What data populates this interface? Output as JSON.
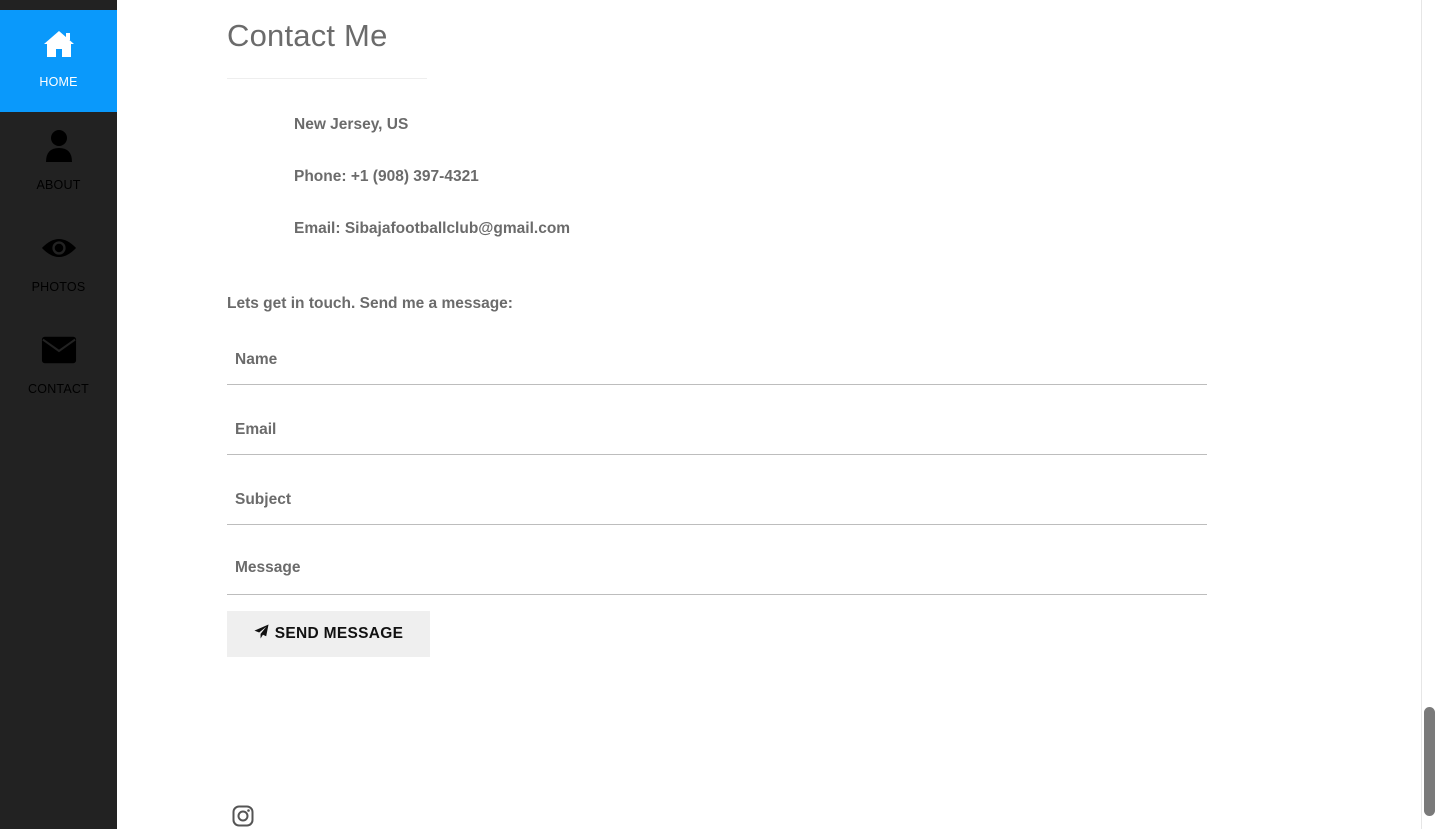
{
  "sidebar": {
    "items": [
      {
        "label": "HOME",
        "icon": "home-icon",
        "active": true
      },
      {
        "label": "ABOUT",
        "icon": "user-icon",
        "active": false
      },
      {
        "label": "PHOTOS",
        "icon": "eye-icon",
        "active": false
      },
      {
        "label": "CONTACT",
        "icon": "envelope-icon",
        "active": false
      }
    ],
    "accent_color": "#0a99fb",
    "background_color": "#222222"
  },
  "contact": {
    "title": "Contact Me",
    "address": "New Jersey, US",
    "phone": "Phone: +1 (908) 397-4321",
    "email": "Email: Sibajafootballclub@gmail.com",
    "intro": "Lets get in touch. Send me a message:"
  },
  "form": {
    "name_placeholder": "Name",
    "email_placeholder": "Email",
    "subject_placeholder": "Subject",
    "message_placeholder": "Message",
    "send_label": "SEND MESSAGE",
    "send_icon": "paper-plane-icon"
  },
  "footer": {
    "social_icon": "instagram-icon"
  }
}
